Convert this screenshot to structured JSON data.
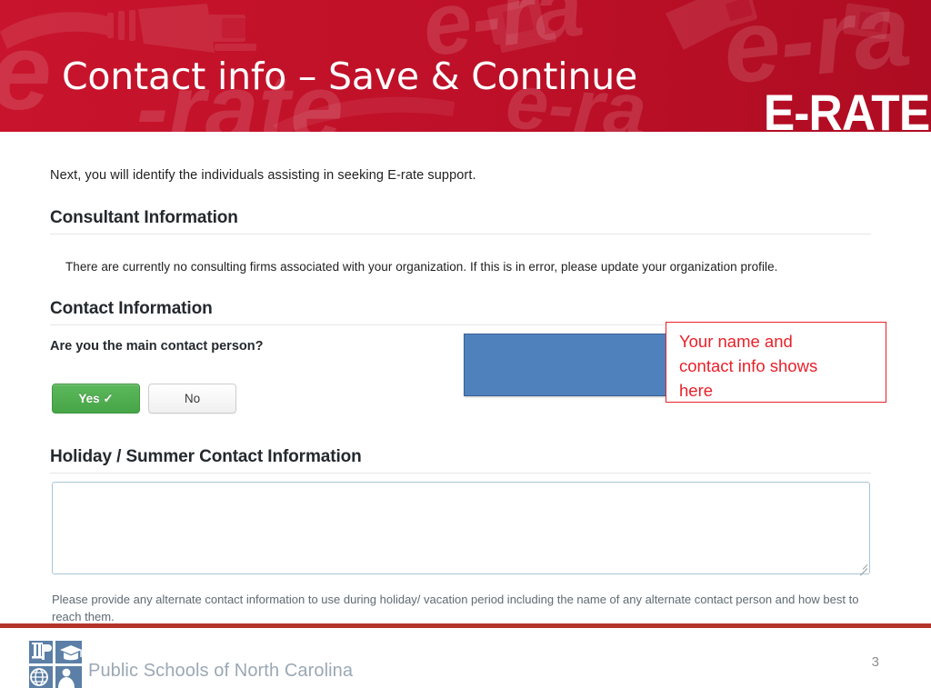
{
  "slide": {
    "title": "Contact info – Save & Continue",
    "brand_logo_text": "E-RATE",
    "page_number": "3"
  },
  "content": {
    "intro_text": "Next, you will identify the individuals assisting in seeking E-rate support.",
    "consultant_section": {
      "heading": "Consultant Information",
      "note": "There are currently no consulting firms associated with your organization. If this is in error, please update your organization profile."
    },
    "contact_section": {
      "heading": "Contact Information",
      "question": "Are you the main contact person?",
      "buttons": {
        "yes_label": "Yes ✓",
        "no_label": "No"
      },
      "redacted_block_color": "#4f81bd"
    },
    "annotation": {
      "text": "Your name and\ncontact info shows\nhere",
      "color": "#e8212a"
    },
    "holiday_section": {
      "heading": "Holiday / Summer Contact Information",
      "textarea_value": "",
      "textarea_placeholder": "",
      "helper_text": "Please provide any alternate contact information to use during holiday/ vacation period including the name of any alternate contact person and how best to reach them."
    }
  },
  "footer": {
    "organization": "Public Schools of North Carolina",
    "logo_icons": [
      "column-icon",
      "graduation-cap-icon",
      "globe-icon",
      "person-icon"
    ],
    "divider_color": "#b5342a"
  },
  "theme": {
    "banner_color": "#c0102a",
    "banner_watermark_text": "e-rate",
    "green_button": "#46a546",
    "accent_red": "#e8212a"
  }
}
